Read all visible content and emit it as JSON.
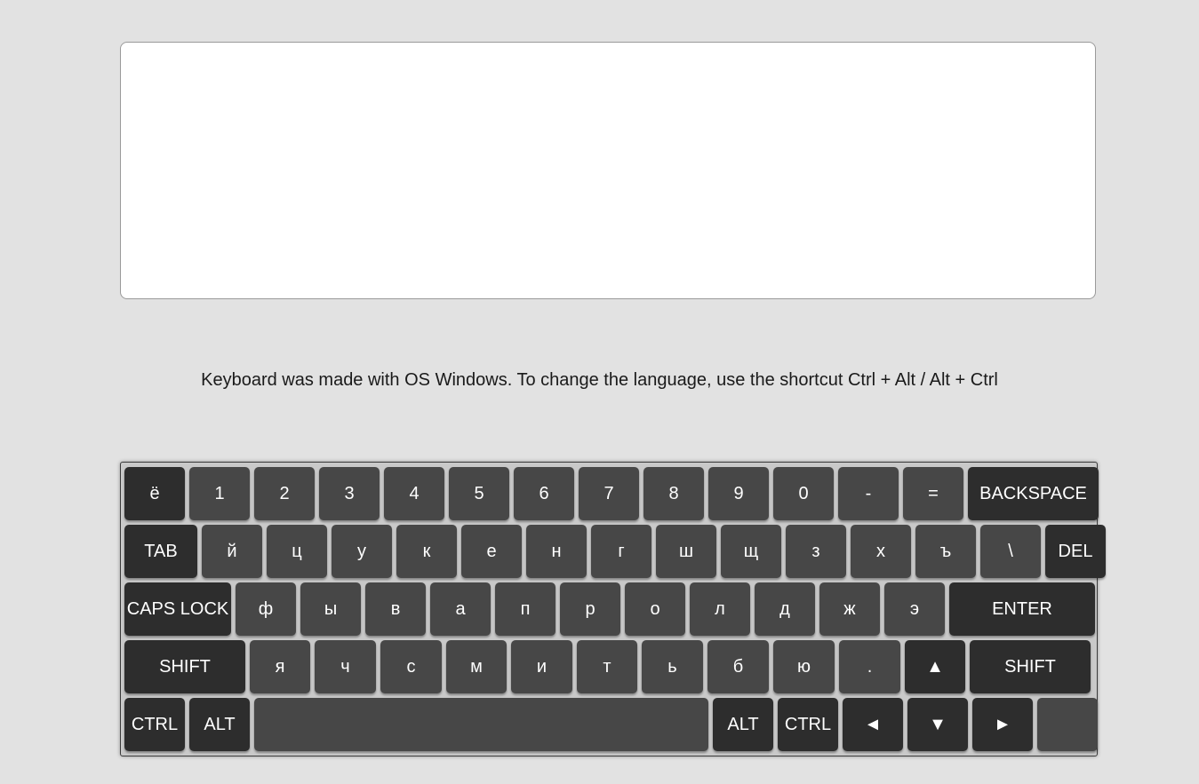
{
  "textarea": {
    "value": ""
  },
  "hint": "Keyboard was made with OS Windows. To change the language, use the shortcut Ctrl + Alt / Alt + Ctrl",
  "keyboard": {
    "rows": [
      [
        {
          "label": "ё",
          "name": "key-yo",
          "dark": true
        },
        {
          "label": "1",
          "name": "key-1"
        },
        {
          "label": "2",
          "name": "key-2"
        },
        {
          "label": "3",
          "name": "key-3"
        },
        {
          "label": "4",
          "name": "key-4"
        },
        {
          "label": "5",
          "name": "key-5"
        },
        {
          "label": "6",
          "name": "key-6"
        },
        {
          "label": "7",
          "name": "key-7"
        },
        {
          "label": "8",
          "name": "key-8"
        },
        {
          "label": "9",
          "name": "key-9"
        },
        {
          "label": "0",
          "name": "key-0"
        },
        {
          "label": "-",
          "name": "key-minus"
        },
        {
          "label": "=",
          "name": "key-equal"
        },
        {
          "label": "BACKSPACE",
          "name": "key-backspace",
          "dark": true
        }
      ],
      [
        {
          "label": "TAB",
          "name": "key-tab",
          "dark": true
        },
        {
          "label": "й",
          "name": "key-i-short"
        },
        {
          "label": "ц",
          "name": "key-ts"
        },
        {
          "label": "у",
          "name": "key-u"
        },
        {
          "label": "к",
          "name": "key-k"
        },
        {
          "label": "е",
          "name": "key-ye"
        },
        {
          "label": "н",
          "name": "key-n"
        },
        {
          "label": "г",
          "name": "key-g"
        },
        {
          "label": "ш",
          "name": "key-sh"
        },
        {
          "label": "щ",
          "name": "key-shch"
        },
        {
          "label": "з",
          "name": "key-z"
        },
        {
          "label": "х",
          "name": "key-kh"
        },
        {
          "label": "ъ",
          "name": "key-hard-sign"
        },
        {
          "label": "\\",
          "name": "key-backslash"
        },
        {
          "label": "DEL",
          "name": "key-del",
          "dark": true
        }
      ],
      [
        {
          "label": "CAPS LOCK",
          "name": "key-caps-lock",
          "dark": true
        },
        {
          "label": "ф",
          "name": "key-f"
        },
        {
          "label": "ы",
          "name": "key-y"
        },
        {
          "label": "в",
          "name": "key-v"
        },
        {
          "label": "а",
          "name": "key-a"
        },
        {
          "label": "п",
          "name": "key-p"
        },
        {
          "label": "р",
          "name": "key-r"
        },
        {
          "label": "о",
          "name": "key-o"
        },
        {
          "label": "л",
          "name": "key-l"
        },
        {
          "label": "д",
          "name": "key-d"
        },
        {
          "label": "ж",
          "name": "key-zh"
        },
        {
          "label": "э",
          "name": "key-e"
        },
        {
          "label": "ENTER",
          "name": "key-enter",
          "dark": true
        }
      ],
      [
        {
          "label": "SHIFT",
          "name": "key-shift-left",
          "dark": true
        },
        {
          "label": "я",
          "name": "key-ya"
        },
        {
          "label": "ч",
          "name": "key-ch"
        },
        {
          "label": "с",
          "name": "key-s"
        },
        {
          "label": "м",
          "name": "key-m"
        },
        {
          "label": "и",
          "name": "key-i"
        },
        {
          "label": "т",
          "name": "key-t"
        },
        {
          "label": "ь",
          "name": "key-soft-sign"
        },
        {
          "label": "б",
          "name": "key-b"
        },
        {
          "label": "ю",
          "name": "key-yu"
        },
        {
          "label": ".",
          "name": "key-period"
        },
        {
          "label": "▲",
          "name": "arrow-up-icon",
          "dark": true
        },
        {
          "label": "SHIFT",
          "name": "key-shift-right",
          "dark": true
        }
      ],
      [
        {
          "label": "CTRL",
          "name": "key-ctrl-left",
          "dark": true
        },
        {
          "label": "ALT",
          "name": "key-alt-left",
          "dark": true
        },
        {
          "label": "",
          "name": "key-space"
        },
        {
          "label": "ALT",
          "name": "key-alt-right",
          "dark": true
        },
        {
          "label": "CTRL",
          "name": "key-ctrl-right",
          "dark": true
        },
        {
          "label": "◄",
          "name": "arrow-left-icon",
          "dark": true
        },
        {
          "label": "▼",
          "name": "arrow-down-icon",
          "dark": true
        },
        {
          "label": "►",
          "name": "arrow-right-icon",
          "dark": true
        },
        {
          "label": "",
          "name": "key-blank"
        }
      ]
    ]
  }
}
